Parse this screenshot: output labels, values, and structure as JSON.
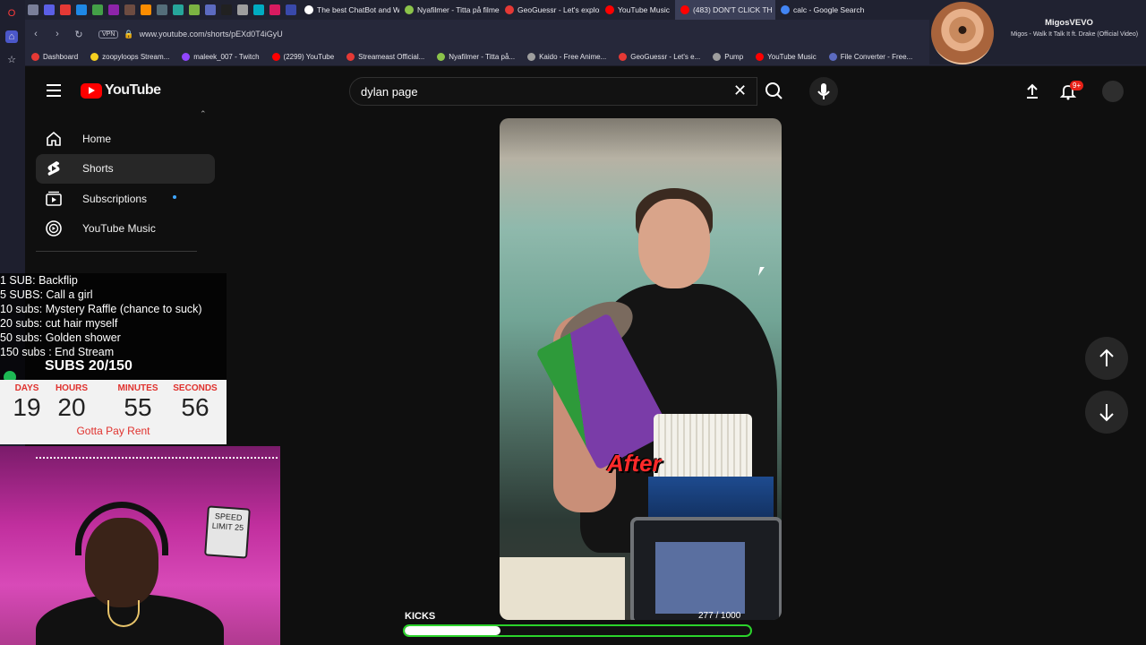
{
  "browser": {
    "tabs": [
      {
        "label": "The best ChatBot and Wi",
        "color": "#ffffff"
      },
      {
        "label": "Nyafilmer - Titta på filmer",
        "color": "#8bc34a"
      },
      {
        "label": "GeoGuessr - Let's explore",
        "color": "#e53935"
      },
      {
        "label": "YouTube Music",
        "color": "#ff0000"
      },
      {
        "label": "(483) DON'T CLICK TH",
        "color": "#ff0000",
        "active": true
      },
      {
        "label": "calc - Google Search",
        "color": "#4285f4"
      }
    ],
    "url": "www.youtube.com/shorts/pEXd0T4iGyU",
    "vpn": "VPN",
    "bookmarks": [
      {
        "label": "Dashboard",
        "color": "#e53935"
      },
      {
        "label": "zoopyloops Stream...",
        "color": "#f5d020"
      },
      {
        "label": "maleek_007 - Twitch",
        "color": "#9146ff"
      },
      {
        "label": "(2299) YouTube",
        "color": "#ff0000"
      },
      {
        "label": "Streameast Official...",
        "color": "#e53935"
      },
      {
        "label": "Nyafilmer - Titta på...",
        "color": "#8bc34a"
      },
      {
        "label": "Kaido - Free Anime...",
        "color": "#9e9e9e"
      },
      {
        "label": "GeoGuessr - Let's e...",
        "color": "#e53935"
      },
      {
        "label": "Pump",
        "color": "#9e9e9e"
      },
      {
        "label": "YouTube Music",
        "color": "#ff0000"
      },
      {
        "label": "File Converter - Free...",
        "color": "#5c6bc0"
      }
    ]
  },
  "media_player": {
    "artist": "MigosVEVO",
    "title": "Migos - Walk It Talk It ft. Drake (Official Video)"
  },
  "youtube": {
    "logo_text": "YouTube",
    "search_value": "dylan page",
    "notification_badge": "9+",
    "sidebar": [
      {
        "label": "Home",
        "icon": "home-icon"
      },
      {
        "label": "Shorts",
        "icon": "shorts-icon",
        "selected": true
      },
      {
        "label": "Subscriptions",
        "icon": "subscriptions-icon"
      },
      {
        "label": "YouTube Music",
        "icon": "youtube-music-icon"
      }
    ],
    "short": {
      "caption": "After"
    }
  },
  "overlay": {
    "goals": [
      "1 SUB: Backflip",
      "5 SUBS: Call a girl",
      "10 subs: Mystery Raffle (chance to suck)",
      "20 subs: cut hair myself",
      "50 subs: Golden shower",
      "150 subs : End Stream"
    ],
    "subs_progress": "SUBS 20/150",
    "timer": {
      "days_label": "DAYS",
      "days": "19",
      "hours_label": "HOURS",
      "hours": "20",
      "minutes_label": "MINUTES",
      "minutes": "55",
      "seconds_label": "SECONDS",
      "seconds": "56"
    },
    "rent_text": "Gotta Pay Rent",
    "cam_sign": "SPEED LIMIT 25",
    "kicks": {
      "label": "KICKS",
      "count_text": "277  / 1000",
      "current": 277,
      "goal": 1000
    }
  },
  "colors": {
    "accent_red": "#ff0000",
    "kicks_green": "#2bd32b",
    "timer_red": "#e0322e"
  }
}
